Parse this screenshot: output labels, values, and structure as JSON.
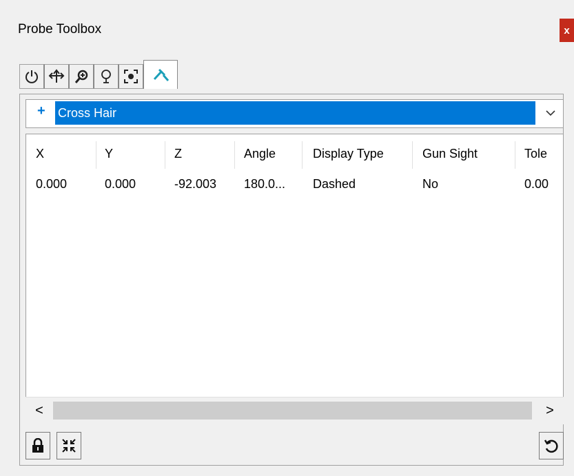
{
  "window": {
    "title": "Probe Toolbox",
    "close_label": "x"
  },
  "tabs": [
    {
      "icon": "power-icon"
    },
    {
      "icon": "move-arrows-icon"
    },
    {
      "icon": "zoom-icon"
    },
    {
      "icon": "lightbulb-icon"
    },
    {
      "icon": "focus-target-icon"
    },
    {
      "icon": "probe-tool-icon",
      "active": true
    }
  ],
  "combo": {
    "value": "Cross Hair",
    "icon": "crosshair-plus-icon"
  },
  "table": {
    "columns": [
      "X",
      "Y",
      "Z",
      "Angle",
      "Display Type",
      "Gun Sight",
      "Tole"
    ],
    "rows": [
      [
        "0.000",
        "0.000",
        "-92.003",
        "180.0...",
        "Dashed",
        "No",
        "0.00"
      ]
    ]
  },
  "scrollbar": {
    "left_arrow": "<",
    "right_arrow": ">"
  },
  "footer": {
    "lock_icon": "lock-icon",
    "collapse_icon": "collapse-arrows-icon",
    "refresh_icon": "refresh-icon"
  },
  "colors": {
    "selection": "#0078d7",
    "close_bg": "#c42b1c",
    "active_icon": "#1b9fb8"
  }
}
